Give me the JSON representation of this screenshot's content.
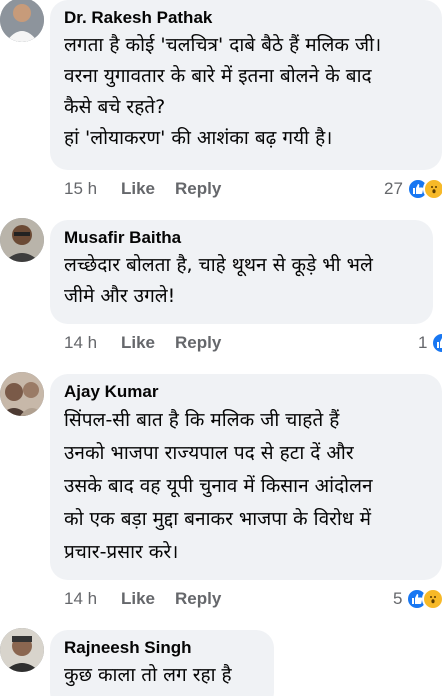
{
  "comments": [
    {
      "author": "Dr. Rakesh Pathak",
      "lines": [
        "लगता है कोई 'चलचित्र' दाबे बैठे हैं मलिक जी।",
        "वरना युगावतार के बारे में इतना बोलने के बाद",
        "कैसे बचे रहते?",
        "हां 'लोयाकरण' की आशंका बढ़ गयी है।"
      ],
      "time": "15 h",
      "like_label": "Like",
      "reply_label": "Reply",
      "reaction_count": "27"
    },
    {
      "author": "Musafir Baitha",
      "lines": [
        "लच्छेदार बोलता है, चाहे थूथन से कूड़े भी भले",
        "जीमे और उगले!"
      ],
      "time": "14 h",
      "like_label": "Like",
      "reply_label": "Reply",
      "reaction_count": "1"
    },
    {
      "author": "Ajay Kumar",
      "lines": [
        "सिंपल-सी बात है कि मलिक जी चाहते हैं",
        "उनको भाजपा राज्यपाल पद से हटा दें और",
        "उसके बाद वह यूपी चुनाव में किसान आंदोलन",
        "को एक बड़ा मुद्दा बनाकर भाजपा के विरोध में",
        "प्रचार-प्रसार करे।"
      ],
      "time": "14 h",
      "like_label": "Like",
      "reply_label": "Reply",
      "reaction_count": "5"
    },
    {
      "author": "Rajneesh Singh",
      "lines": [
        "कुछ काला तो लग रहा है"
      ]
    }
  ],
  "icons": {
    "like": "like-icon",
    "love": "love-icon",
    "wow": "wow-icon"
  },
  "colors": {
    "bubble": "#f0f2f5",
    "meta_text": "#65676b",
    "like_blue": "#1877f2",
    "love_red": "#f33e58",
    "wow_yellow": "#f7b928"
  }
}
